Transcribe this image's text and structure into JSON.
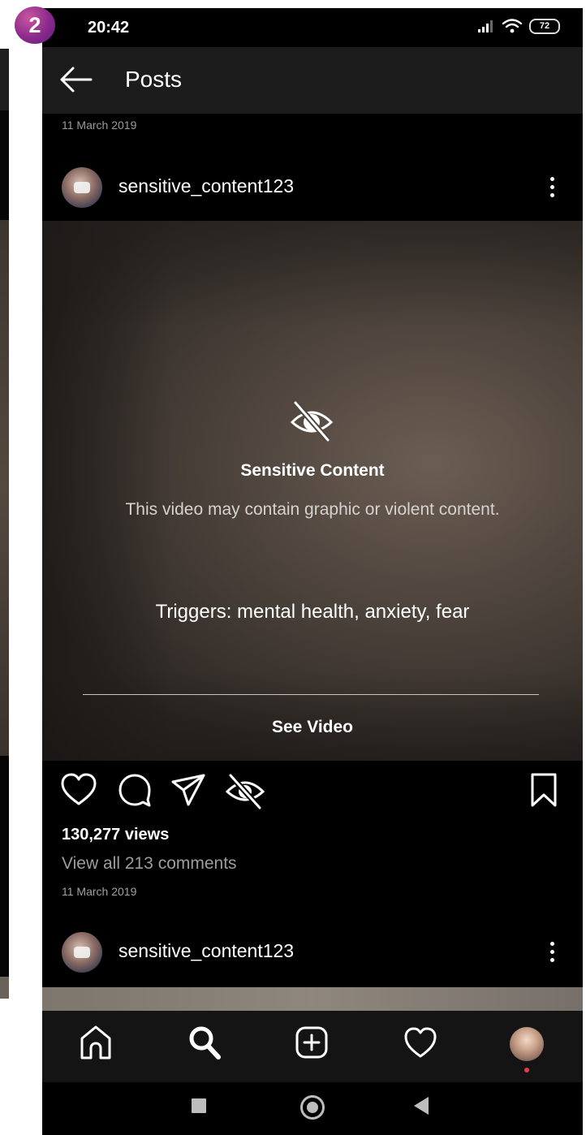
{
  "badge": {
    "number": "2"
  },
  "status_bar": {
    "time": "20:42",
    "battery": "72"
  },
  "header": {
    "title": "Posts"
  },
  "top_post": {
    "date": "11 March 2019"
  },
  "post": {
    "username": "sensitive_content123",
    "warning_title": "Sensitive Content",
    "warning_text": "This video may contain graphic or violent content.",
    "triggers": "Triggers: mental health, anxiety, fear",
    "see_video_label": "See Video",
    "views": "130,277 views",
    "comments_link": "View all 213 comments",
    "date": "11 March 2019"
  },
  "next_post": {
    "username": "sensitive_content123"
  },
  "icons": {
    "back": "back-arrow-icon",
    "more": "more-vertical-icon",
    "hidden": "eye-off-icon",
    "like": "heart-icon",
    "comment": "comment-icon",
    "share": "send-icon",
    "hide": "eye-off-icon",
    "save": "bookmark-icon",
    "home": "home-icon",
    "search": "search-icon",
    "create": "add-post-icon",
    "activity": "heart-icon"
  },
  "colors": {
    "background": "#000000",
    "header": "#1c1c1c",
    "notification_dot": "#e8394d",
    "badge": "#8a2a8c"
  }
}
